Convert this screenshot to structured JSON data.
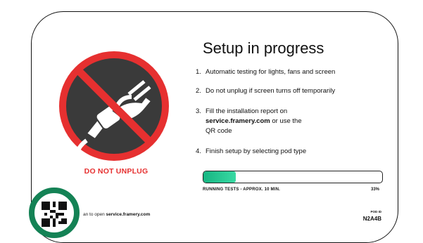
{
  "warning": "DO NOT UNPLUG",
  "title": "Setup in progress",
  "steps": {
    "s1": {
      "num": "1.",
      "text": "Automatic testing for lights, fans and screen"
    },
    "s2": {
      "num": "2.",
      "text": "Do not unplug if screen turns off temporarily"
    },
    "s3": {
      "num": "3.",
      "line1": "Fill the installation report on",
      "link": "service.framery.com",
      "line2": " or use the",
      "line3": "QR code"
    },
    "s4": {
      "num": "4.",
      "text": "Finish setup by selecting pod type"
    }
  },
  "progress": {
    "label": "RUNNING TESTS - APPROX. 10 MIN.",
    "percent_text": "33%",
    "fraction": 0.18
  },
  "qr": {
    "prefix": "an to open ",
    "link": "service.framery.com"
  },
  "pod": {
    "label": "POD ID",
    "id": "N2A4B"
  },
  "colors": {
    "accent": "#17b582",
    "warning": "#e63030",
    "qr_ring": "#148255",
    "sign_bg": "#3a3a3a"
  },
  "icons": {
    "sign": "no-unplug-icon",
    "qr": "qr-code-icon"
  }
}
